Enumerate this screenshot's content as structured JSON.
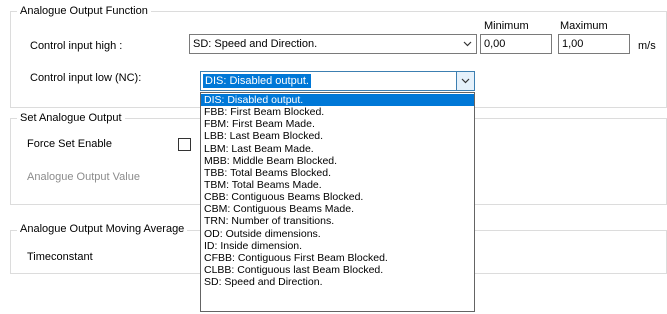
{
  "analogue_output_function": {
    "legend": "Analogue Output Function",
    "minimum_label": "Minimum",
    "maximum_label": "Maximum",
    "control_input_high": {
      "label": "Control input high :",
      "value": "SD: Speed and Direction.",
      "minimum": "0,00",
      "maximum": "1,00",
      "unit": "m/s"
    },
    "control_input_low": {
      "label": "Control input low  (NC):",
      "value": "DIS: Disabled output."
    }
  },
  "set_analogue_output": {
    "legend": "Set Analogue Output",
    "force_set_enable_label": "Force Set Enable",
    "force_set_enable_checked": false,
    "analogue_output_value_label": "Analogue Output Value"
  },
  "moving_average": {
    "legend": "Analogue Output Moving Average",
    "timeconstant_label": "Timeconstant"
  },
  "dropdown": {
    "selected_index": 0,
    "options": [
      "DIS: Disabled output.",
      "FBB: First Beam Blocked.",
      "FBM: First Beam Made.",
      "LBB: Last Beam Blocked.",
      "LBM: Last Beam Made.",
      "MBB: Middle Beam Blocked.",
      "TBB: Total Beams Blocked.",
      "TBM: Total Beams Made.",
      "CBB: Contiguous Beams Blocked.",
      "CBM: Contiguous Beams Made.",
      "TRN: Number of transitions.",
      "OD: Outside dimensions.",
      "ID: Inside dimension.",
      "CFBB: Contiguous First Beam Blocked.",
      "CLBB: Contiguous last Beam Blocked.",
      "SD: Speed and Direction."
    ]
  },
  "icons": {
    "combo_arrow": "chevron-down-icon"
  }
}
